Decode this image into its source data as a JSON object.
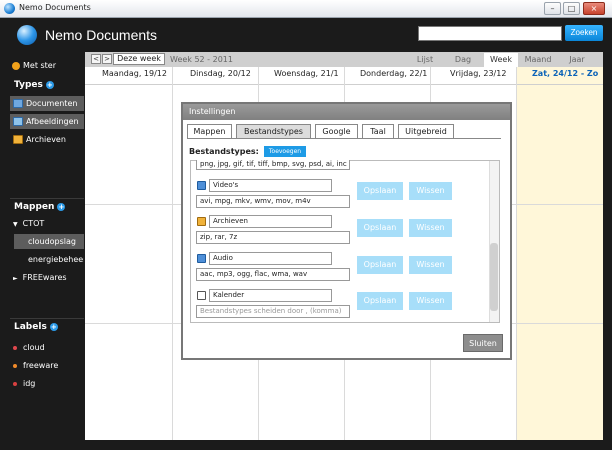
{
  "window": {
    "title": "Nemo Documents",
    "controls": {
      "minimize": "–",
      "maximize": "□",
      "close": "×"
    }
  },
  "header": {
    "title": "Nemo Documents",
    "search_placeholder": "",
    "search_button": "Zoeken"
  },
  "sidebar": {
    "starred": "Met ster",
    "types_heading": "Types",
    "types": [
      "Documenten",
      "Afbeeldingen",
      "Archieven"
    ],
    "folders_heading": "Mappen",
    "folders": [
      {
        "label": "CTOT",
        "indicator": "▼"
      },
      {
        "label": "cloudopslag",
        "indicator": ""
      },
      {
        "label": "energiebeheer",
        "indicator": ""
      },
      {
        "label": "FREEwares",
        "indicator": "►"
      }
    ],
    "labels_heading": "Labels",
    "labels": [
      {
        "label": "cloud",
        "color": "#e0484d"
      },
      {
        "label": "freeware",
        "color": "#f08a2a"
      },
      {
        "label": "idg",
        "color": "#d84040"
      }
    ],
    "plus": "+"
  },
  "calendar": {
    "prev": "<",
    "next": ">",
    "this_week": "Deze week",
    "week_label": "Week 52 - 2011",
    "views": [
      "Lijst",
      "Dag",
      "Week",
      "Maand",
      "Jaar"
    ],
    "active_view": "Week",
    "days": [
      "Maandag, 19/12",
      "Dinsdag, 20/12",
      "Woensdag, 21/1",
      "Donderdag, 22/1",
      "Vrijdag, 23/12",
      "Zat, 24/12 - Zo"
    ],
    "today_color": "#0b63b8"
  },
  "dialog": {
    "title": "Instellingen",
    "tabs": [
      "Mappen",
      "Bestandstypes",
      "Google",
      "Taal",
      "Uitgebreid"
    ],
    "active_tab": "Bestandstypes",
    "section_label": "Bestandstypes:",
    "add_button": "Toevoegen",
    "first_ext": "png, jpg, gif, tif, tiff, bmp, svg, psd, ai, inc",
    "rows": [
      {
        "name": "Video's",
        "extensions": "avi, mpg, mkv, wmv, mov, m4v",
        "icon": "video-icon"
      },
      {
        "name": "Archieven",
        "extensions": "zip, rar, 7z",
        "icon": "archive-icon"
      },
      {
        "name": "Audio",
        "extensions": "aac, mp3, ogg, flac, wma, wav",
        "icon": "audio-icon"
      },
      {
        "name": "Kalender",
        "extensions_placeholder": "Bestandstypes scheiden door , (komma)",
        "icon": "calendar-icon"
      }
    ],
    "save_label": "Opslaan",
    "delete_label": "Wissen",
    "close_label": "Sluiten"
  }
}
